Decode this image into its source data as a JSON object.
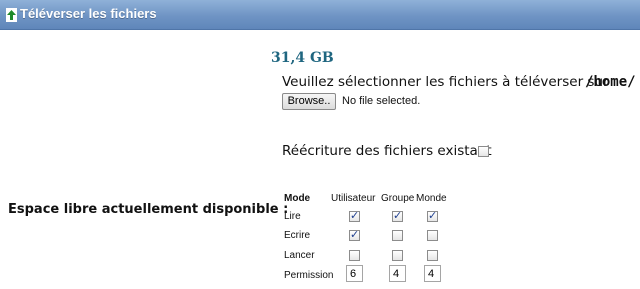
{
  "header": {
    "title": "Téléverser les fichiers",
    "icon": "upload-arrow-icon"
  },
  "upload": {
    "free_space": "31,4 GB",
    "select_label": "Veuillez sélectionner les fichiers à téléverser sur",
    "target_path": "/home/",
    "browse_label": "Browse..",
    "file_status": "No file selected.",
    "overwrite_label": "Réécriture des fichiers existant",
    "overwrite_checked": false
  },
  "free_space_label": "Espace libre actuellement disponible :",
  "permissions": {
    "headers": {
      "mode": "Mode",
      "user": "Utilisateur",
      "group": "Groupe",
      "world": "Monde"
    },
    "rows": [
      {
        "label": "Lire",
        "user": true,
        "group": true,
        "world": true
      },
      {
        "label": "Ecrire",
        "user": true,
        "group": false,
        "world": false
      },
      {
        "label": "Lancer",
        "user": false,
        "group": false,
        "world": false
      }
    ],
    "permission_label": "Permission",
    "values": {
      "user": "6",
      "group": "4",
      "world": "4"
    }
  },
  "colors": {
    "titlebar": "#6f94c4",
    "free_space_text": "#1f6680",
    "checkmark": "#1f3f8f"
  }
}
